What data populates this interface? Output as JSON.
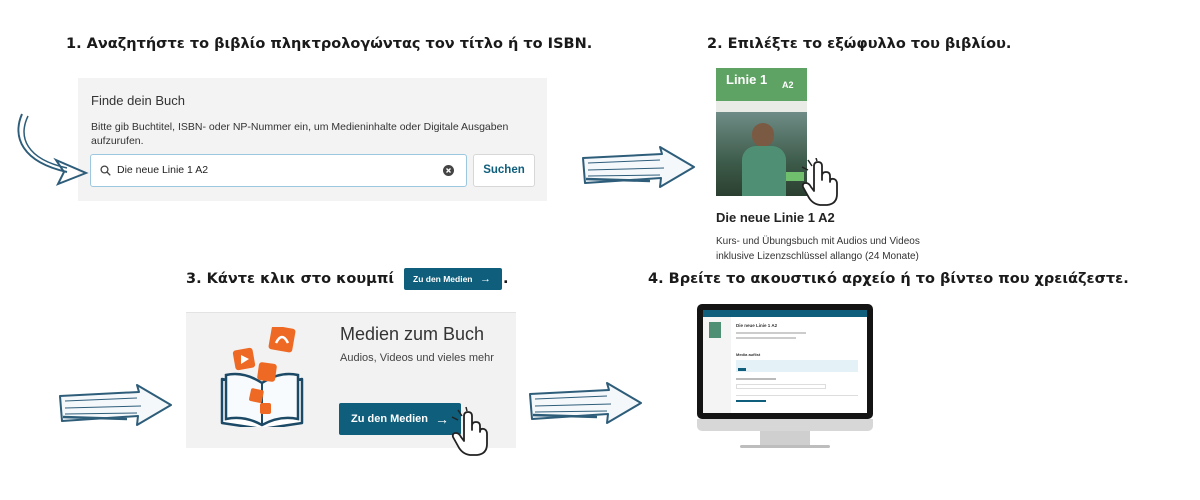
{
  "step1": {
    "title": "1. Αναζητήστε το βιβλίο πληκτρολογώντας τον τίτλο ή το ISBN.",
    "panel_heading": "Finde dein Buch",
    "panel_description": "Bitte gib Buchtitel, ISBN- oder NP-Nummer ein, um Medieninhalte oder Digitale Ausgaben aufzurufen.",
    "search_value": "Die neue Linie 1 A2",
    "search_button": "Suchen"
  },
  "step2": {
    "title": "2. Επιλέξτε το εξώφυλλο του βιβλίου.",
    "cover_series": "Linie 1",
    "cover_level": "A2",
    "book_title": "Die neue Linie 1 A2",
    "book_line1": "Kurs- und Übungsbuch mit Audios und Videos",
    "book_line2": "inklusive Lizenzschlüssel allango (24 Monate)"
  },
  "step3": {
    "title_text": "3. Κάντε κλικ στο κουμπί",
    "title_end": ".",
    "inline_button": "Zu den Medien",
    "inline_arrow": "→",
    "panel_heading": "Medien zum Buch",
    "panel_sub": "Audios, Videos und vieles mehr",
    "panel_button": "Zu den Medien",
    "panel_arrow": "→"
  },
  "step4": {
    "title": "4. Βρείτε το ακουστικό αρχείο ή το βίντεο που χρειάζεστε.",
    "screen_book_title": "Die neue Linie 1 A2",
    "screen_section": "Media auflist"
  },
  "colors": {
    "accent": "#0e5e7c",
    "arrow": "#2e5d7a",
    "media_icon": "#ee6a24"
  },
  "icons": [
    "search-icon",
    "clear-icon",
    "arrow-right-icon",
    "hand-cursor-icon",
    "open-book-icon",
    "headphones-icon",
    "play-icon",
    "hand-drawn-arrow-icon"
  ]
}
